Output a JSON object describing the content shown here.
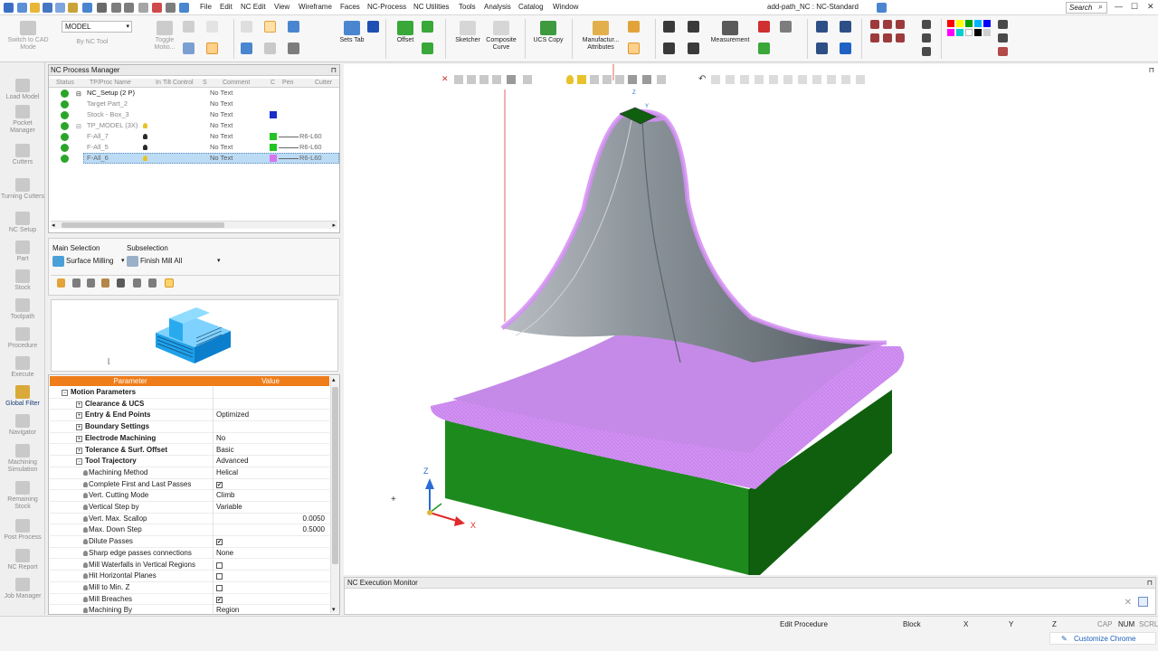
{
  "titlebar": {
    "menus": [
      "File",
      "Edit",
      "NC Edit",
      "View",
      "Wireframe",
      "Faces",
      "NC-Process",
      "NC Utilities",
      "Tools",
      "Analysis",
      "Catalog",
      "Window"
    ],
    "doc_title": "add-path_NC : NC-Standard",
    "search_placeholder": "Search",
    "min": "—",
    "max": "☐",
    "close": "✕"
  },
  "ribbon": {
    "model_dropdown": "MODEL",
    "buttons": {
      "switch_cad": "Switch to CAD Mode",
      "by_nc_tool": "By NC Tool",
      "toggle_motion": "Toggle Motio...",
      "sets_tab": "Sets Tab",
      "offset": "Offset",
      "sketcher": "Sketcher",
      "composite_curve": "Composite Curve",
      "ucs_copy": "UCS Copy",
      "manufacturing_attributes": "Manufactur... Attributes",
      "measurement": "Measurement"
    }
  },
  "rail": {
    "items": [
      "Load Model",
      "Pocket Manager",
      "Cutters",
      "Turning Cutters",
      "NC Setup",
      "Part",
      "Stock",
      "Toolpath",
      "Procedure",
      "Execute",
      "Global Filter",
      "Navigator",
      "Machining Simulation",
      "Remaining Stock",
      "Post Process",
      "NC Report",
      "Job Manager"
    ]
  },
  "process_manager": {
    "title": "NC Process Manager",
    "columns": [
      "Status",
      "TP/Proc Name",
      "In",
      "Tilt Control",
      "S",
      "Comment",
      "C",
      "Pen",
      "Cutter"
    ],
    "rows": [
      {
        "name": "NC_Setup (2 P)",
        "comment": "No Text",
        "cutter": "",
        "pen_color": "",
        "indent": 0
      },
      {
        "name": "Target Part_2",
        "comment": "No Text",
        "cutter": "",
        "pen_color": "",
        "indent": 1
      },
      {
        "name": "Stock - Box_3",
        "comment": "No Text",
        "cutter": "",
        "pen_color": "#1a2fc9",
        "indent": 1
      },
      {
        "name": "TP_MODEL (3X)",
        "comment": "No Text",
        "cutter": "",
        "pen_color": "",
        "indent": 0
      },
      {
        "name": "F-All_7",
        "comment": "No Text",
        "cutter": "R6-L60",
        "pen_color": "#23c423",
        "indent": 1
      },
      {
        "name": "F-All_5",
        "comment": "No Text",
        "cutter": "R6-L60",
        "pen_color": "#23c423",
        "indent": 1
      },
      {
        "name": "F-All_6",
        "comment": "No Text",
        "cutter": "R6-L60",
        "pen_color": "#d774f0",
        "indent": 1
      }
    ]
  },
  "selection": {
    "main_label": "Main Selection",
    "sub_label": "Subselection",
    "main_value": "Surface Milling",
    "sub_value": "Finish Mill All"
  },
  "params": {
    "header_param": "Parameter",
    "header_value": "Value",
    "rows": [
      {
        "label": "Motion Parameters",
        "value": "",
        "type": "group"
      },
      {
        "label": "Clearance & UCS",
        "value": "",
        "type": "sub"
      },
      {
        "label": "Entry & End Points",
        "value": "Optimized",
        "type": "sub"
      },
      {
        "label": "Boundary Settings",
        "value": "",
        "type": "sub"
      },
      {
        "label": "Electrode Machining",
        "value": "No",
        "type": "sub"
      },
      {
        "label": "Tolerance & Surf. Offset",
        "value": "Basic",
        "type": "sub"
      },
      {
        "label": "Tool Trajectory",
        "value": "Advanced",
        "type": "open"
      },
      {
        "label": "Machining Method",
        "value": "Helical",
        "type": "leaf"
      },
      {
        "label": "Complete First and Last Passes",
        "value": "✔",
        "type": "check"
      },
      {
        "label": "Vert. Cutting Mode",
        "value": "Climb",
        "type": "leaf"
      },
      {
        "label": "Vertical Step by",
        "value": "Variable",
        "type": "leaf"
      },
      {
        "label": "Vert. Max. Scallop",
        "value": "0.0050",
        "type": "num"
      },
      {
        "label": "Max. Down Step",
        "value": "0.5000",
        "type": "num"
      },
      {
        "label": "Dilute Passes",
        "value": "✔",
        "type": "check"
      },
      {
        "label": "Sharp edge passes connections",
        "value": "None",
        "type": "leaf"
      },
      {
        "label": "Mill Waterfalls in Vertical Regions",
        "value": "",
        "type": "check"
      },
      {
        "label": "Hit Horizontal Planes",
        "value": "",
        "type": "check"
      },
      {
        "label": "Mill to Min. Z",
        "value": "",
        "type": "check"
      },
      {
        "label": "Mill Breaches",
        "value": "✔",
        "type": "check"
      },
      {
        "label": "Machining By",
        "value": "Region",
        "type": "leaf"
      }
    ]
  },
  "viewport": {
    "axis_x": "X",
    "axis_z": "Z",
    "axis_y": "Y",
    "colors": {
      "base": "#1f8f1f",
      "toolpath": "#c47be8",
      "peak": "#9aa0a6"
    }
  },
  "exec_monitor": {
    "title": "NC Execution Monitor"
  },
  "statusbar": {
    "mode": "Edit Procedure",
    "block": "Block",
    "x": "X",
    "y": "Y",
    "z": "Z",
    "cap": "CAP",
    "num": "NUM",
    "scrl": "SCRL",
    "chrome": "Customize Chrome"
  }
}
